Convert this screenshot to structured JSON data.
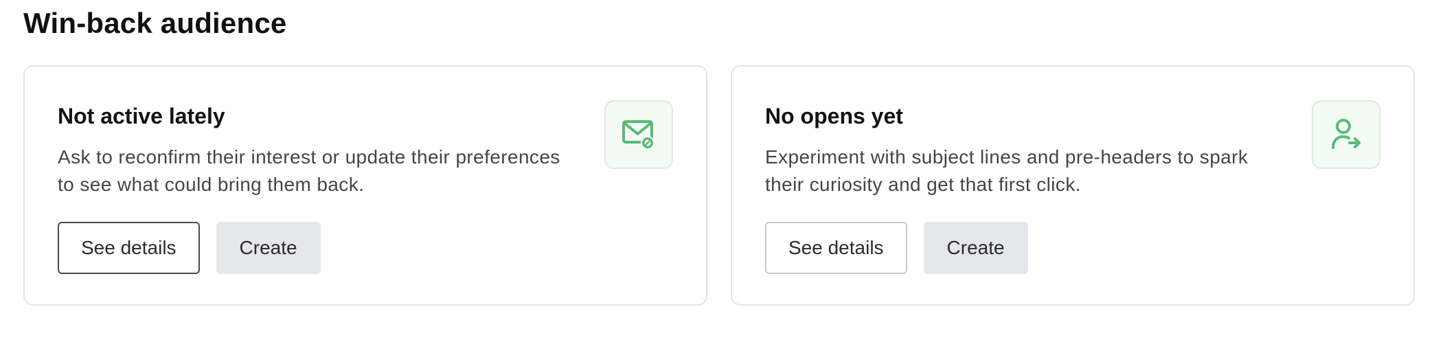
{
  "section": {
    "title": "Win-back audience"
  },
  "cards": [
    {
      "title": "Not active lately",
      "description": "Ask to reconfirm their interest or update their preferences to see what could bring them back.",
      "icon": "mail-blocked-icon",
      "see_details_label": "See details",
      "create_label": "Create"
    },
    {
      "title": "No opens yet",
      "description": "Experiment with subject lines and pre-headers to spark their curiosity and get that first click.",
      "icon": "user-arrow-icon",
      "see_details_label": "See details",
      "create_label": "Create"
    }
  ],
  "colors": {
    "icon_accent": "#5cb878",
    "icon_tile_bg": "#f3fbf5",
    "card_border": "#e3e4e7",
    "filled_button_bg": "#e6e7ea"
  }
}
